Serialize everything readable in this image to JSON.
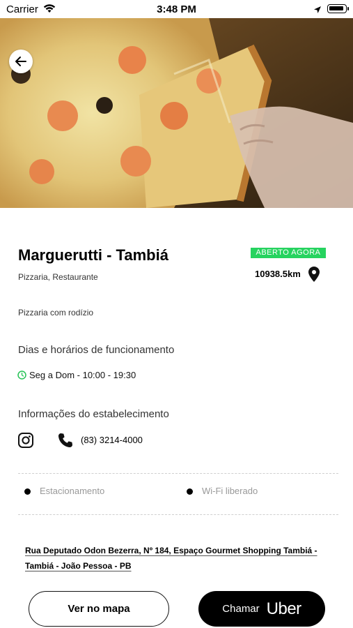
{
  "status_bar": {
    "carrier": "Carrier",
    "time": "3:48 PM"
  },
  "header": {
    "back_icon": "arrow-left-icon"
  },
  "restaurant": {
    "name": "Marguerutti - Tambiá",
    "categories": "Pizzaria, Restaurante",
    "status": "ABERTO AGORA",
    "status_color": "#26d35f",
    "distance": "10938.5km",
    "description": "Pizzaria com rodízio"
  },
  "hours": {
    "title": "Dias e horários de funcionamento",
    "schedule": "Seg a Dom - 10:00 - 19:30"
  },
  "info": {
    "title": "Informações do estabelecimento",
    "phone": "(83) 3214-4000"
  },
  "amenities": [
    {
      "label": "Estacionamento"
    },
    {
      "label": "Wi-Fi liberado"
    }
  ],
  "address": "Rua Deputado Odon Bezerra, Nº 184, Espaço Gourmet Shopping Tambiá - Tambiá - João Pessoa - PB",
  "actions": {
    "map_label": "Ver no mapa",
    "uber_label": "Chamar",
    "uber_brand": "Uber"
  }
}
